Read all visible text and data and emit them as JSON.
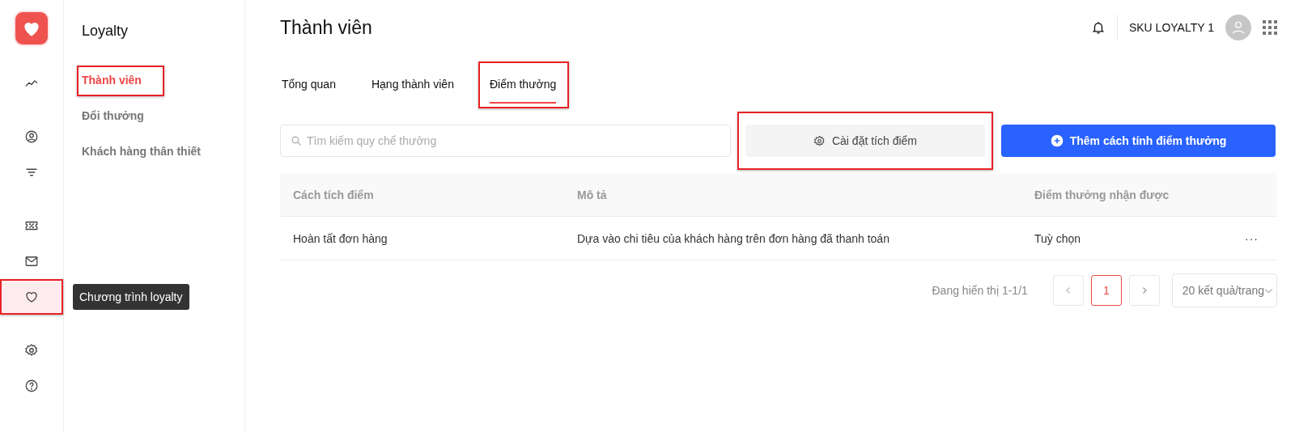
{
  "rail": {
    "groups": [
      [
        {
          "selected": false,
          "highlighted": false
        }
      ],
      [
        {
          "selected": false,
          "highlighted": false
        },
        {
          "selected": false,
          "highlighted": false
        }
      ],
      [
        {
          "selected": false,
          "highlighted": false
        },
        {
          "selected": false,
          "highlighted": false
        },
        {
          "selected": true,
          "highlighted": true
        }
      ],
      [
        {
          "selected": false,
          "highlighted": false
        },
        {
          "selected": false,
          "highlighted": false
        }
      ]
    ],
    "tooltip": "Chương trình loyalty"
  },
  "subnav": {
    "title": "Loyalty",
    "items": [
      {
        "label": "Thành viên",
        "selected": true,
        "highlighted": true
      },
      {
        "label": "Đổi thưởng",
        "selected": false,
        "highlighted": false
      },
      {
        "label": "Khách hàng thân thiết",
        "selected": false,
        "highlighted": false
      }
    ]
  },
  "header": {
    "title": "Thành viên",
    "user": "SKU LOYALTY 1"
  },
  "tabs": [
    {
      "label": "Tổng quan",
      "selected": false,
      "highlighted": false
    },
    {
      "label": "Hạng thành viên",
      "selected": false,
      "highlighted": false
    },
    {
      "label": "Điểm thưởng",
      "selected": true,
      "highlighted": true
    }
  ],
  "search": {
    "placeholder": "Tìm kiếm quy chế thưởng"
  },
  "buttons": [
    {
      "label": "Cài đặt tích điểm",
      "kind": "secondary",
      "highlighted": true
    },
    {
      "label": "Thêm cách tính điểm thưởng",
      "kind": "primary",
      "highlighted": false
    }
  ],
  "table": {
    "columns": [
      "Cách tích điểm",
      "Mô tả",
      "Điểm thưởng nhận được"
    ],
    "rows": [
      {
        "cells": [
          "Hoàn tất đơn hàng",
          "Dựa vào chi tiêu của khách hàng trên đơn hàng đã thanh toán",
          "Tuỳ chọn"
        ],
        "menu": "···"
      }
    ]
  },
  "pagination": {
    "summary": "Đang hiển thị 1-1/1",
    "pages": [
      {
        "label": "1",
        "selected": true
      }
    ],
    "page_size": "20 kết quả/trang"
  }
}
